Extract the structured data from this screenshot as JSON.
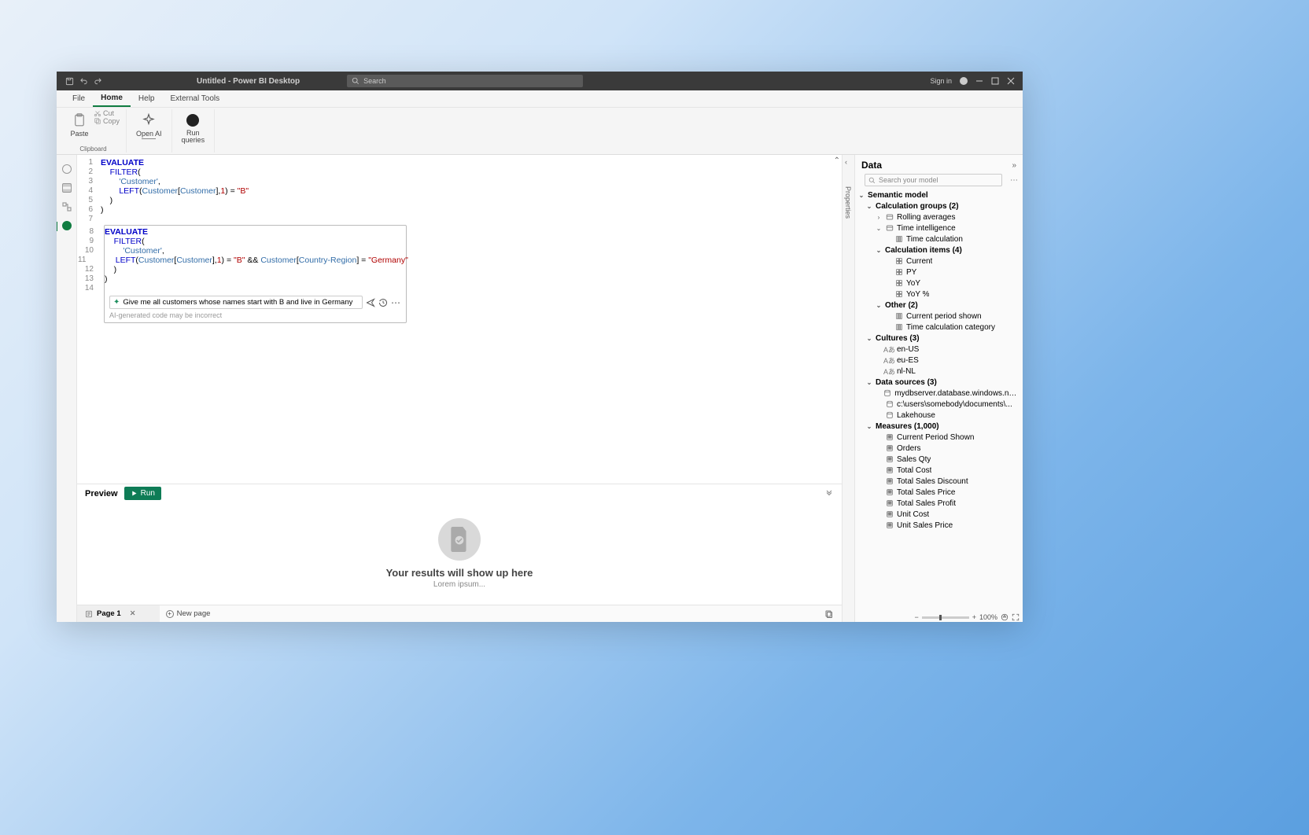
{
  "titlebar": {
    "title": "Untitled - Power BI Desktop",
    "search_placeholder": "Search",
    "signin": "Sign in"
  },
  "ribbon_tabs": [
    "File",
    "Home",
    "Help",
    "External Tools"
  ],
  "ribbon": {
    "clipboard": {
      "paste": "Paste",
      "cut": "Cut",
      "copy": "Copy",
      "group_label": "Clipboard"
    },
    "openai": "Open AI",
    "run_queries": "Run\nqueries"
  },
  "code": {
    "lines": [
      {
        "n": 1,
        "tokens": [
          {
            "t": "EVALUATE",
            "c": "kw"
          }
        ]
      },
      {
        "n": 2,
        "tokens": [
          {
            "t": "    ",
            "c": ""
          },
          {
            "t": "FILTER",
            "c": "fn"
          },
          {
            "t": "(",
            "c": ""
          }
        ]
      },
      {
        "n": 3,
        "tokens": [
          {
            "t": "        ",
            "c": ""
          },
          {
            "t": "'Customer'",
            "c": "ident"
          },
          {
            "t": ",",
            "c": ""
          }
        ]
      },
      {
        "n": 4,
        "tokens": [
          {
            "t": "        ",
            "c": ""
          },
          {
            "t": "LEFT",
            "c": "fn"
          },
          {
            "t": "(",
            "c": ""
          },
          {
            "t": "Customer",
            "c": "ident"
          },
          {
            "t": "[",
            "c": ""
          },
          {
            "t": "Customer",
            "c": "ident"
          },
          {
            "t": "],",
            "c": ""
          },
          {
            "t": "1",
            "c": "lit"
          },
          {
            "t": ") = ",
            "c": ""
          },
          {
            "t": "\"B\"",
            "c": "str"
          }
        ]
      },
      {
        "n": 5,
        "tokens": [
          {
            "t": "    )",
            "c": ""
          }
        ]
      },
      {
        "n": 6,
        "tokens": [
          {
            "t": ")",
            "c": ""
          }
        ]
      },
      {
        "n": 7,
        "tokens": [
          {
            "t": "",
            "c": ""
          }
        ]
      }
    ],
    "ai_lines": [
      {
        "n": 8,
        "tokens": [
          {
            "t": "EVALUATE",
            "c": "kw"
          }
        ]
      },
      {
        "n": 9,
        "tokens": [
          {
            "t": "    ",
            "c": ""
          },
          {
            "t": "FILTER",
            "c": "fn"
          },
          {
            "t": "(",
            "c": ""
          }
        ]
      },
      {
        "n": 10,
        "tokens": [
          {
            "t": "        ",
            "c": ""
          },
          {
            "t": "'Customer'",
            "c": "ident"
          },
          {
            "t": ",",
            "c": ""
          }
        ]
      },
      {
        "n": 11,
        "tokens": [
          {
            "t": "        ",
            "c": ""
          },
          {
            "t": "LEFT",
            "c": "fn"
          },
          {
            "t": "(",
            "c": ""
          },
          {
            "t": "Customer",
            "c": "ident"
          },
          {
            "t": "[",
            "c": ""
          },
          {
            "t": "Customer",
            "c": "ident"
          },
          {
            "t": "],",
            "c": ""
          },
          {
            "t": "1",
            "c": "lit"
          },
          {
            "t": ") = ",
            "c": ""
          },
          {
            "t": "\"B\"",
            "c": "str"
          },
          {
            "t": " && ",
            "c": ""
          },
          {
            "t": "Customer",
            "c": "ident"
          },
          {
            "t": "[",
            "c": ""
          },
          {
            "t": "Country-Region",
            "c": "ident"
          },
          {
            "t": "] = ",
            "c": ""
          },
          {
            "t": "\"Germany\"",
            "c": "str"
          }
        ]
      },
      {
        "n": 12,
        "tokens": [
          {
            "t": "    )",
            "c": ""
          }
        ]
      },
      {
        "n": 13,
        "tokens": [
          {
            "t": ")",
            "c": ""
          }
        ]
      },
      {
        "n": 14,
        "tokens": [
          {
            "t": "",
            "c": ""
          }
        ]
      }
    ],
    "ai_prompt": "Give me all customers whose names start with B and live in Germany",
    "ai_note": "AI-generated code may be incorrect"
  },
  "preview": {
    "label": "Preview",
    "run": "Run",
    "headline": "Your results will show up here",
    "sub": "Lorem ipsum..."
  },
  "pages": {
    "page1": "Page 1",
    "new_page": "New page"
  },
  "props_label": "Properties",
  "data_panel": {
    "title": "Data",
    "search_placeholder": "Search your model",
    "tree": [
      {
        "l": 0,
        "chev": "v",
        "bold": true,
        "text": "Semantic model"
      },
      {
        "l": 1,
        "chev": "v",
        "bold": true,
        "text": "Calculation groups (2)"
      },
      {
        "l": 2,
        "chev": ">",
        "icon": "grp",
        "text": "Rolling averages"
      },
      {
        "l": 2,
        "chev": "v",
        "icon": "grp",
        "text": "Time intelligence"
      },
      {
        "l": 3,
        "icon": "col",
        "text": "Time calculation"
      },
      {
        "l": 2,
        "chev": "v",
        "bold": true,
        "text": "Calculation items (4)"
      },
      {
        "l": 3,
        "icon": "itm",
        "text": "Current"
      },
      {
        "l": 3,
        "icon": "itm",
        "text": "PY"
      },
      {
        "l": 3,
        "icon": "itm",
        "text": "YoY"
      },
      {
        "l": 3,
        "icon": "itm",
        "text": "YoY %"
      },
      {
        "l": 2,
        "chev": "v",
        "bold": true,
        "text": "Other (2)"
      },
      {
        "l": 3,
        "icon": "col",
        "text": "Current period shown"
      },
      {
        "l": 3,
        "icon": "col",
        "text": "Time calculation category"
      },
      {
        "l": 1,
        "chev": "v",
        "bold": true,
        "text": "Cultures (3)"
      },
      {
        "l": 2,
        "icon": "cul",
        "text": "en-US"
      },
      {
        "l": 2,
        "icon": "cul",
        "text": "eu-ES"
      },
      {
        "l": 2,
        "icon": "cul",
        "text": "nl-NL"
      },
      {
        "l": 1,
        "chev": "v",
        "bold": true,
        "text": "Data sources (3)"
      },
      {
        "l": 2,
        "icon": "ds",
        "text": "mydbserver.database.windows.net;MyData..."
      },
      {
        "l": 2,
        "icon": "ds",
        "text": "c:\\users\\somebody\\documents\\..."
      },
      {
        "l": 2,
        "icon": "ds",
        "text": "Lakehouse"
      },
      {
        "l": 1,
        "chev": "v",
        "bold": true,
        "text": "Measures (1,000)"
      },
      {
        "l": 2,
        "icon": "m",
        "text": "Current Period Shown"
      },
      {
        "l": 2,
        "icon": "m",
        "text": "Orders"
      },
      {
        "l": 2,
        "icon": "m",
        "text": "Sales Qty"
      },
      {
        "l": 2,
        "icon": "m",
        "text": "Total Cost"
      },
      {
        "l": 2,
        "icon": "m",
        "text": "Total Sales Discount"
      },
      {
        "l": 2,
        "icon": "m",
        "text": "Total Sales Price"
      },
      {
        "l": 2,
        "icon": "m",
        "text": "Total Sales Profit"
      },
      {
        "l": 2,
        "icon": "m",
        "text": "Unit Cost"
      },
      {
        "l": 2,
        "icon": "m",
        "text": "Unit Sales Price"
      }
    ]
  },
  "zoom": "100%"
}
